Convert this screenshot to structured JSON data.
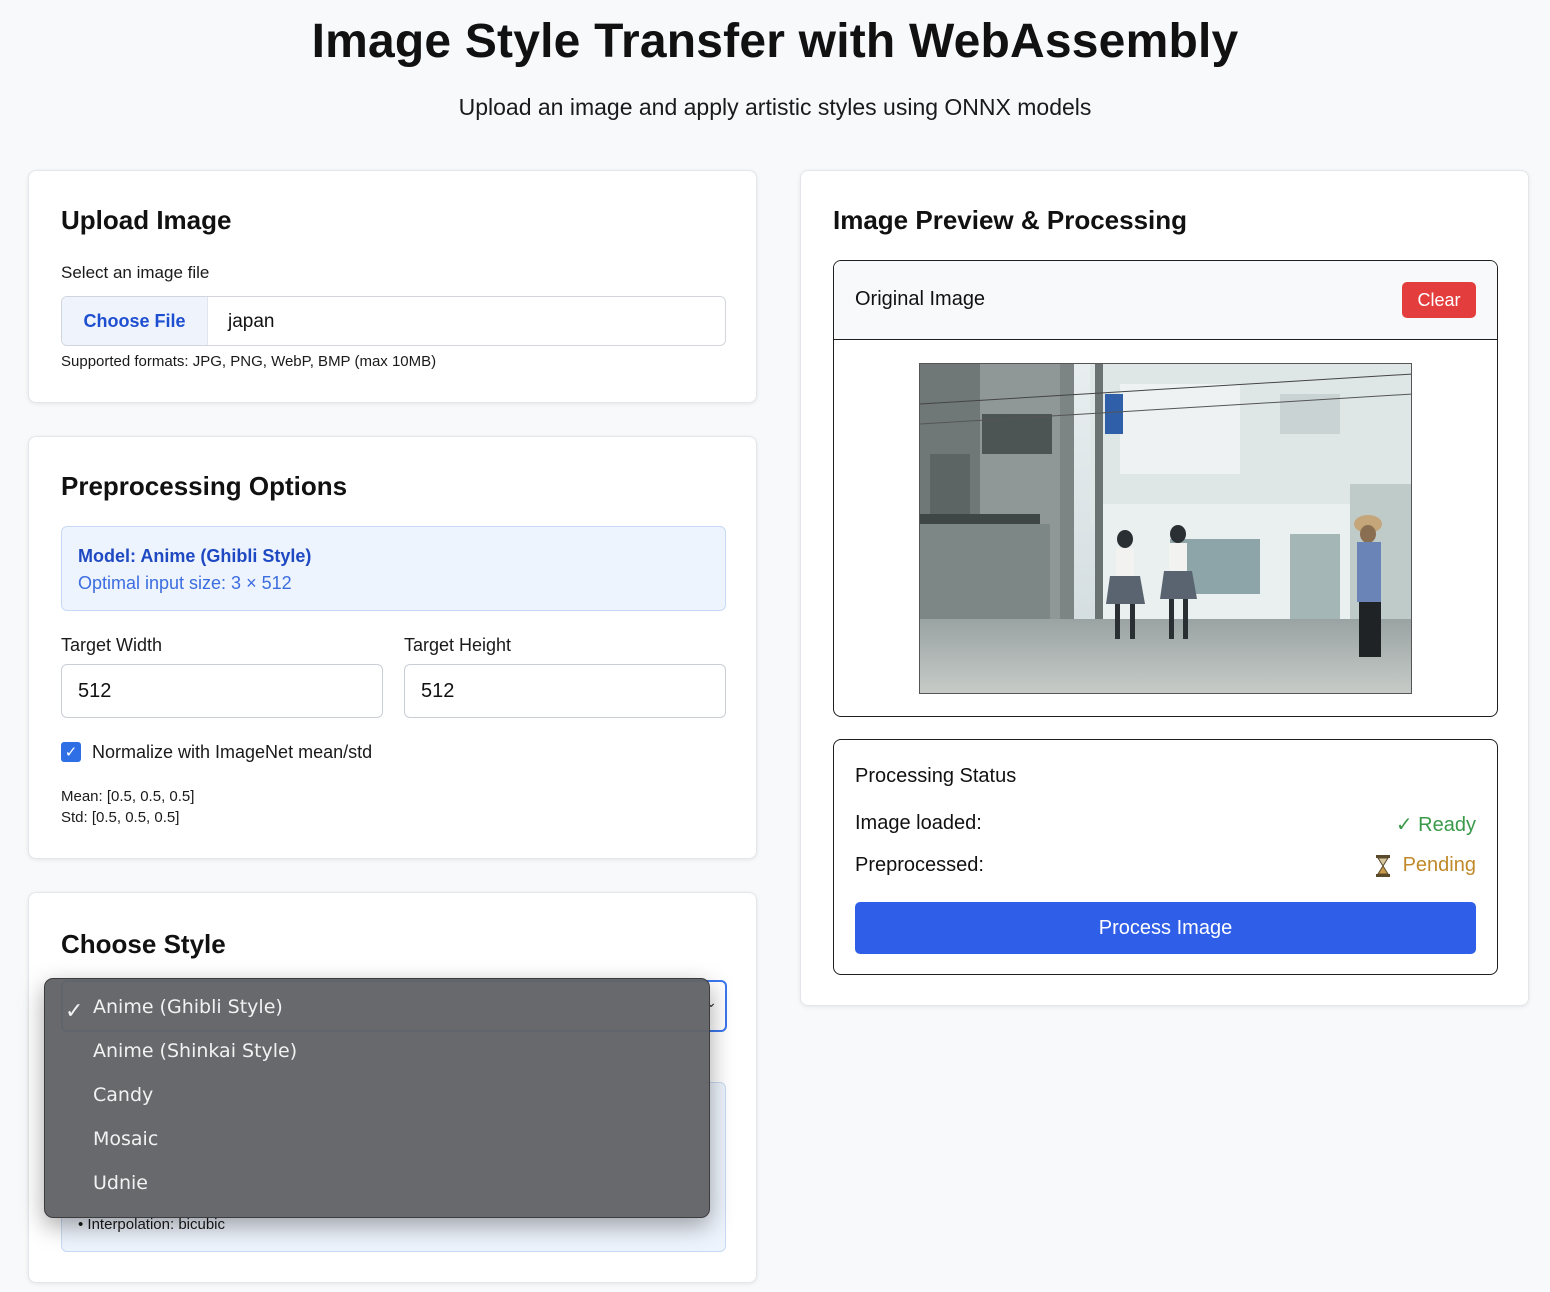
{
  "header": {
    "title": "Image Style Transfer with WebAssembly",
    "subtitle": "Upload an image and apply artistic styles using ONNX models"
  },
  "upload": {
    "title": "Upload Image",
    "label": "Select an image file",
    "choose_button": "Choose File",
    "file_name": "japan",
    "formats": "Supported formats: JPG, PNG, WebP, BMP (max 10MB)"
  },
  "preprocessing": {
    "title": "Preprocessing Options",
    "model_name": "Model: Anime (Ghibli Style)",
    "optimal_size": "Optimal input size: 3 × 512",
    "width_label": "Target Width",
    "width_value": "512",
    "height_label": "Target Height",
    "height_value": "512",
    "normalize_label": "Normalize with ImageNet mean/std",
    "normalize_checked": true,
    "mean": "Mean: [0.5, 0.5, 0.5]",
    "std": "Std: [0.5, 0.5, 0.5]"
  },
  "style": {
    "title": "Choose Style",
    "interpolation": "• Interpolation: bicubic",
    "options": [
      "Anime (Ghibli Style)",
      "Anime (Shinkai Style)",
      "Candy",
      "Mosaic",
      "Udnie"
    ],
    "selected": "Anime (Ghibli Style)",
    "check_glyph": "✓"
  },
  "preview": {
    "title": "Image Preview & Processing",
    "original_label": "Original Image",
    "clear_button": "Clear"
  },
  "status": {
    "title": "Processing Status",
    "image_loaded_label": "Image loaded:",
    "image_loaded_value": "✓ Ready",
    "preprocessed_label": "Preprocessed:",
    "preprocessed_value": "Pending",
    "process_button": "Process Image",
    "colors": {
      "ready": "#3a9a4a",
      "pending": "#c08a2a"
    }
  }
}
